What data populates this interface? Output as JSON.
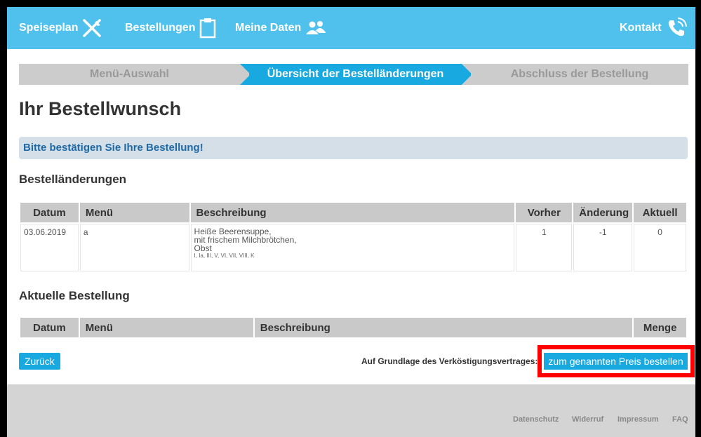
{
  "nav": {
    "speiseplan": "Speiseplan",
    "bestellungen": "Bestellungen",
    "meine_daten": "Meine Daten",
    "kontakt": "Kontakt"
  },
  "steps": {
    "step1": "Menü-Auswahl",
    "step2": "Übersicht der Bestelländerungen",
    "step3": "Abschluss der Bestellung"
  },
  "page_title": "Ihr Bestellwunsch",
  "alert": "Bitte bestätigen Sie Ihre Bestellung!",
  "changes": {
    "heading": "Bestelländerungen",
    "columns": [
      "Datum",
      "Menü",
      "Beschreibung",
      "Vorher",
      "Änderung",
      "Aktuell"
    ],
    "rows": [
      {
        "datum": "03.06.2019",
        "menu": "a",
        "desc_lines": [
          "Heiße Beerensuppe,",
          "mit frischem Milchbrötchen,",
          "Obst"
        ],
        "allergens": "I, Ia, III, V, VI, VII, VIII, K",
        "vorher": "1",
        "aenderung": "-1",
        "aktuell": "0"
      }
    ]
  },
  "current": {
    "heading": "Aktuelle Bestellung",
    "columns": [
      "Datum",
      "Menü",
      "Beschreibung",
      "Menge"
    ]
  },
  "actions": {
    "back": "Zurück",
    "contract_label": "Auf Grundlage des Verköstigungsvertrages:",
    "order": "zum genannten Preis bestellen"
  },
  "footer": {
    "datenschutz": "Datenschutz",
    "widerruf": "Widerruf",
    "impressum": "Impressum",
    "faq": "FAQ"
  },
  "colors": {
    "header": "#4fc1ec",
    "accent": "#19a9e1",
    "highlight": "#ff0000"
  }
}
